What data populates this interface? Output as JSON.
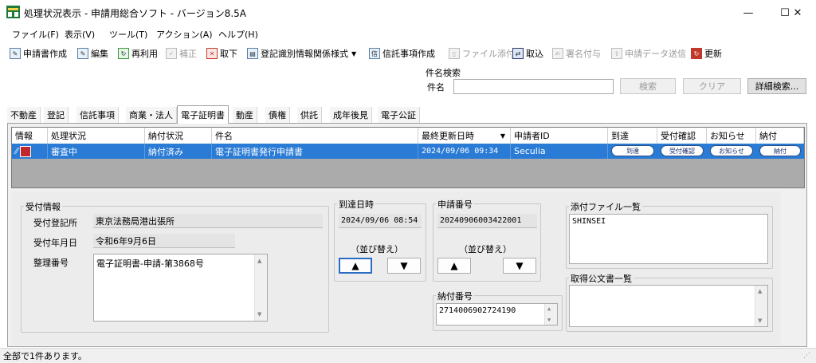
{
  "window": {
    "title": "処理状況表示 - 申請用総合ソフト - バージョン8.5A",
    "controls": [
      "—",
      "☐",
      "✕"
    ]
  },
  "menu": [
    "ファイル(F)",
    "表示(V)",
    "ツール(T)",
    "アクション(A)",
    "ヘルプ(H)"
  ],
  "toolbar": [
    {
      "label": "申請書作成",
      "icon": "document-new-icon",
      "enabled": true
    },
    {
      "label": "編集",
      "icon": "edit-icon",
      "enabled": true
    },
    {
      "label": "再利用",
      "icon": "recycle-icon",
      "enabled": true
    },
    {
      "label": "補正",
      "icon": "correct-icon",
      "enabled": false
    },
    {
      "label": "取下",
      "icon": "withdraw-icon",
      "enabled": true
    },
    {
      "label": "登記識別情報関係様式",
      "icon": "registry-form-icon",
      "enabled": true
    },
    {
      "label": "信託事項作成",
      "icon": "trust-icon",
      "enabled": true
    },
    {
      "label": "ファイル添付",
      "icon": "attach-icon",
      "enabled": false
    },
    {
      "label": "取込",
      "icon": "import-icon",
      "enabled": true
    },
    {
      "label": "署名付与",
      "icon": "signature-icon",
      "enabled": false
    },
    {
      "label": "申請データ送信",
      "icon": "send-icon",
      "enabled": false
    },
    {
      "label": "更新",
      "icon": "refresh-icon",
      "enabled": true
    }
  ],
  "search": {
    "legend": "件名検索",
    "label": "件名",
    "value": "",
    "search_button": "検索",
    "clear_button": "クリア",
    "advanced_button": "詳細検索..."
  },
  "tabs": [
    "不動産",
    "登記",
    "信託事項",
    "商業・法人",
    "電子証明書",
    "動産",
    "債権",
    "供託",
    "成年後見",
    "電子公証"
  ],
  "active_tab": "電子証明書",
  "grid": {
    "columns": [
      "情報",
      "処理状況",
      "納付状況",
      "件名",
      "最終更新日時",
      "申請者ID",
      "到達",
      "受付確認",
      "お知らせ",
      "納付"
    ],
    "sort_indicator": "▼",
    "rows": [
      {
        "status": "審査中",
        "payment": "納付済み",
        "subject": "電子証明書発行申請書",
        "updated": "2024/09/06 09:34",
        "applicant": "Seculia",
        "arrival_btn": "到達",
        "receipt_btn": "受付確認",
        "notice_btn": "お知らせ",
        "payment_btn": "納付"
      }
    ]
  },
  "detail": {
    "reception": {
      "legend": "受付情報",
      "office_label": "受付登記所",
      "office_value": "東京法務局港出張所",
      "date_label": "受付年月日",
      "date_value": "令和6年9月6日",
      "number_label": "整理番号",
      "number_value": "電子証明書-申請-第3868号"
    },
    "arrival": {
      "legend": "到達日時",
      "value": "2024/09/06 08:54",
      "sort_label": "（並び替え）",
      "up": "▲",
      "down": "▼"
    },
    "application": {
      "legend": "申請番号",
      "value": "20240906003422001",
      "sort_label": "（並び替え）",
      "up": "▲",
      "down": "▼"
    },
    "payment_number": {
      "legend": "納付番号",
      "value": "2714006902724190"
    },
    "attachments": {
      "legend": "添付ファイル一覧",
      "items": "SHINSEI"
    },
    "documents": {
      "legend": "取得公文書一覧",
      "items": ""
    }
  },
  "status_bar": "全部で1件あります。",
  "colors": {
    "selection": "#2a7bd5",
    "grid_empty": "#ababab",
    "panel": "#f0f0f0"
  }
}
